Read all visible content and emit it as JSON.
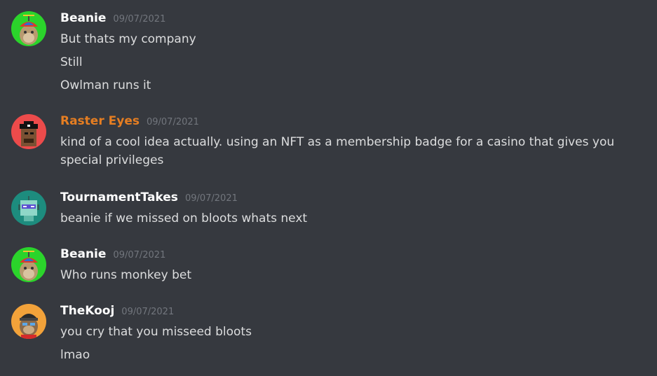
{
  "colors": {
    "background": "#36393f",
    "text": "#dcddde",
    "timestamp": "#72767d",
    "username_default": "#ffffff",
    "username_orange": "#e67e22"
  },
  "messages": [
    {
      "username": "Beanie",
      "timestamp": "09/07/2021",
      "username_color": "#ffffff",
      "avatar": "ape-propeller-hat-avatar",
      "avatar_bg": "#2bd42b",
      "lines": [
        "But thats my company",
        "Still",
        "Owlman runs it"
      ]
    },
    {
      "username": "Raster Eyes",
      "timestamp": "09/07/2021",
      "username_color": "#e67e22",
      "avatar": "pirate-punk-avatar",
      "avatar_bg": "#ec4b4b",
      "lines": [
        "kind of a cool idea actually. using an NFT as a membership badge for a casino that gives you special privileges"
      ]
    },
    {
      "username": "TournamentTakes",
      "timestamp": "09/07/2021",
      "username_color": "#ffffff",
      "avatar": "robot-avatar",
      "avatar_bg": "#1d8c7e",
      "lines": [
        "beanie if we missed on bloots whats next"
      ]
    },
    {
      "username": "Beanie",
      "timestamp": "09/07/2021",
      "username_color": "#ffffff",
      "avatar": "ape-propeller-hat-avatar",
      "avatar_bg": "#2bd42b",
      "lines": [
        "Who runs monkey bet"
      ]
    },
    {
      "username": "TheKooj",
      "timestamp": "09/07/2021",
      "username_color": "#ffffff",
      "avatar": "ape-beanie-avatar",
      "avatar_bg": "#f2a23a",
      "lines": [
        "you cry that you misseed bloots",
        "lmao"
      ]
    }
  ]
}
